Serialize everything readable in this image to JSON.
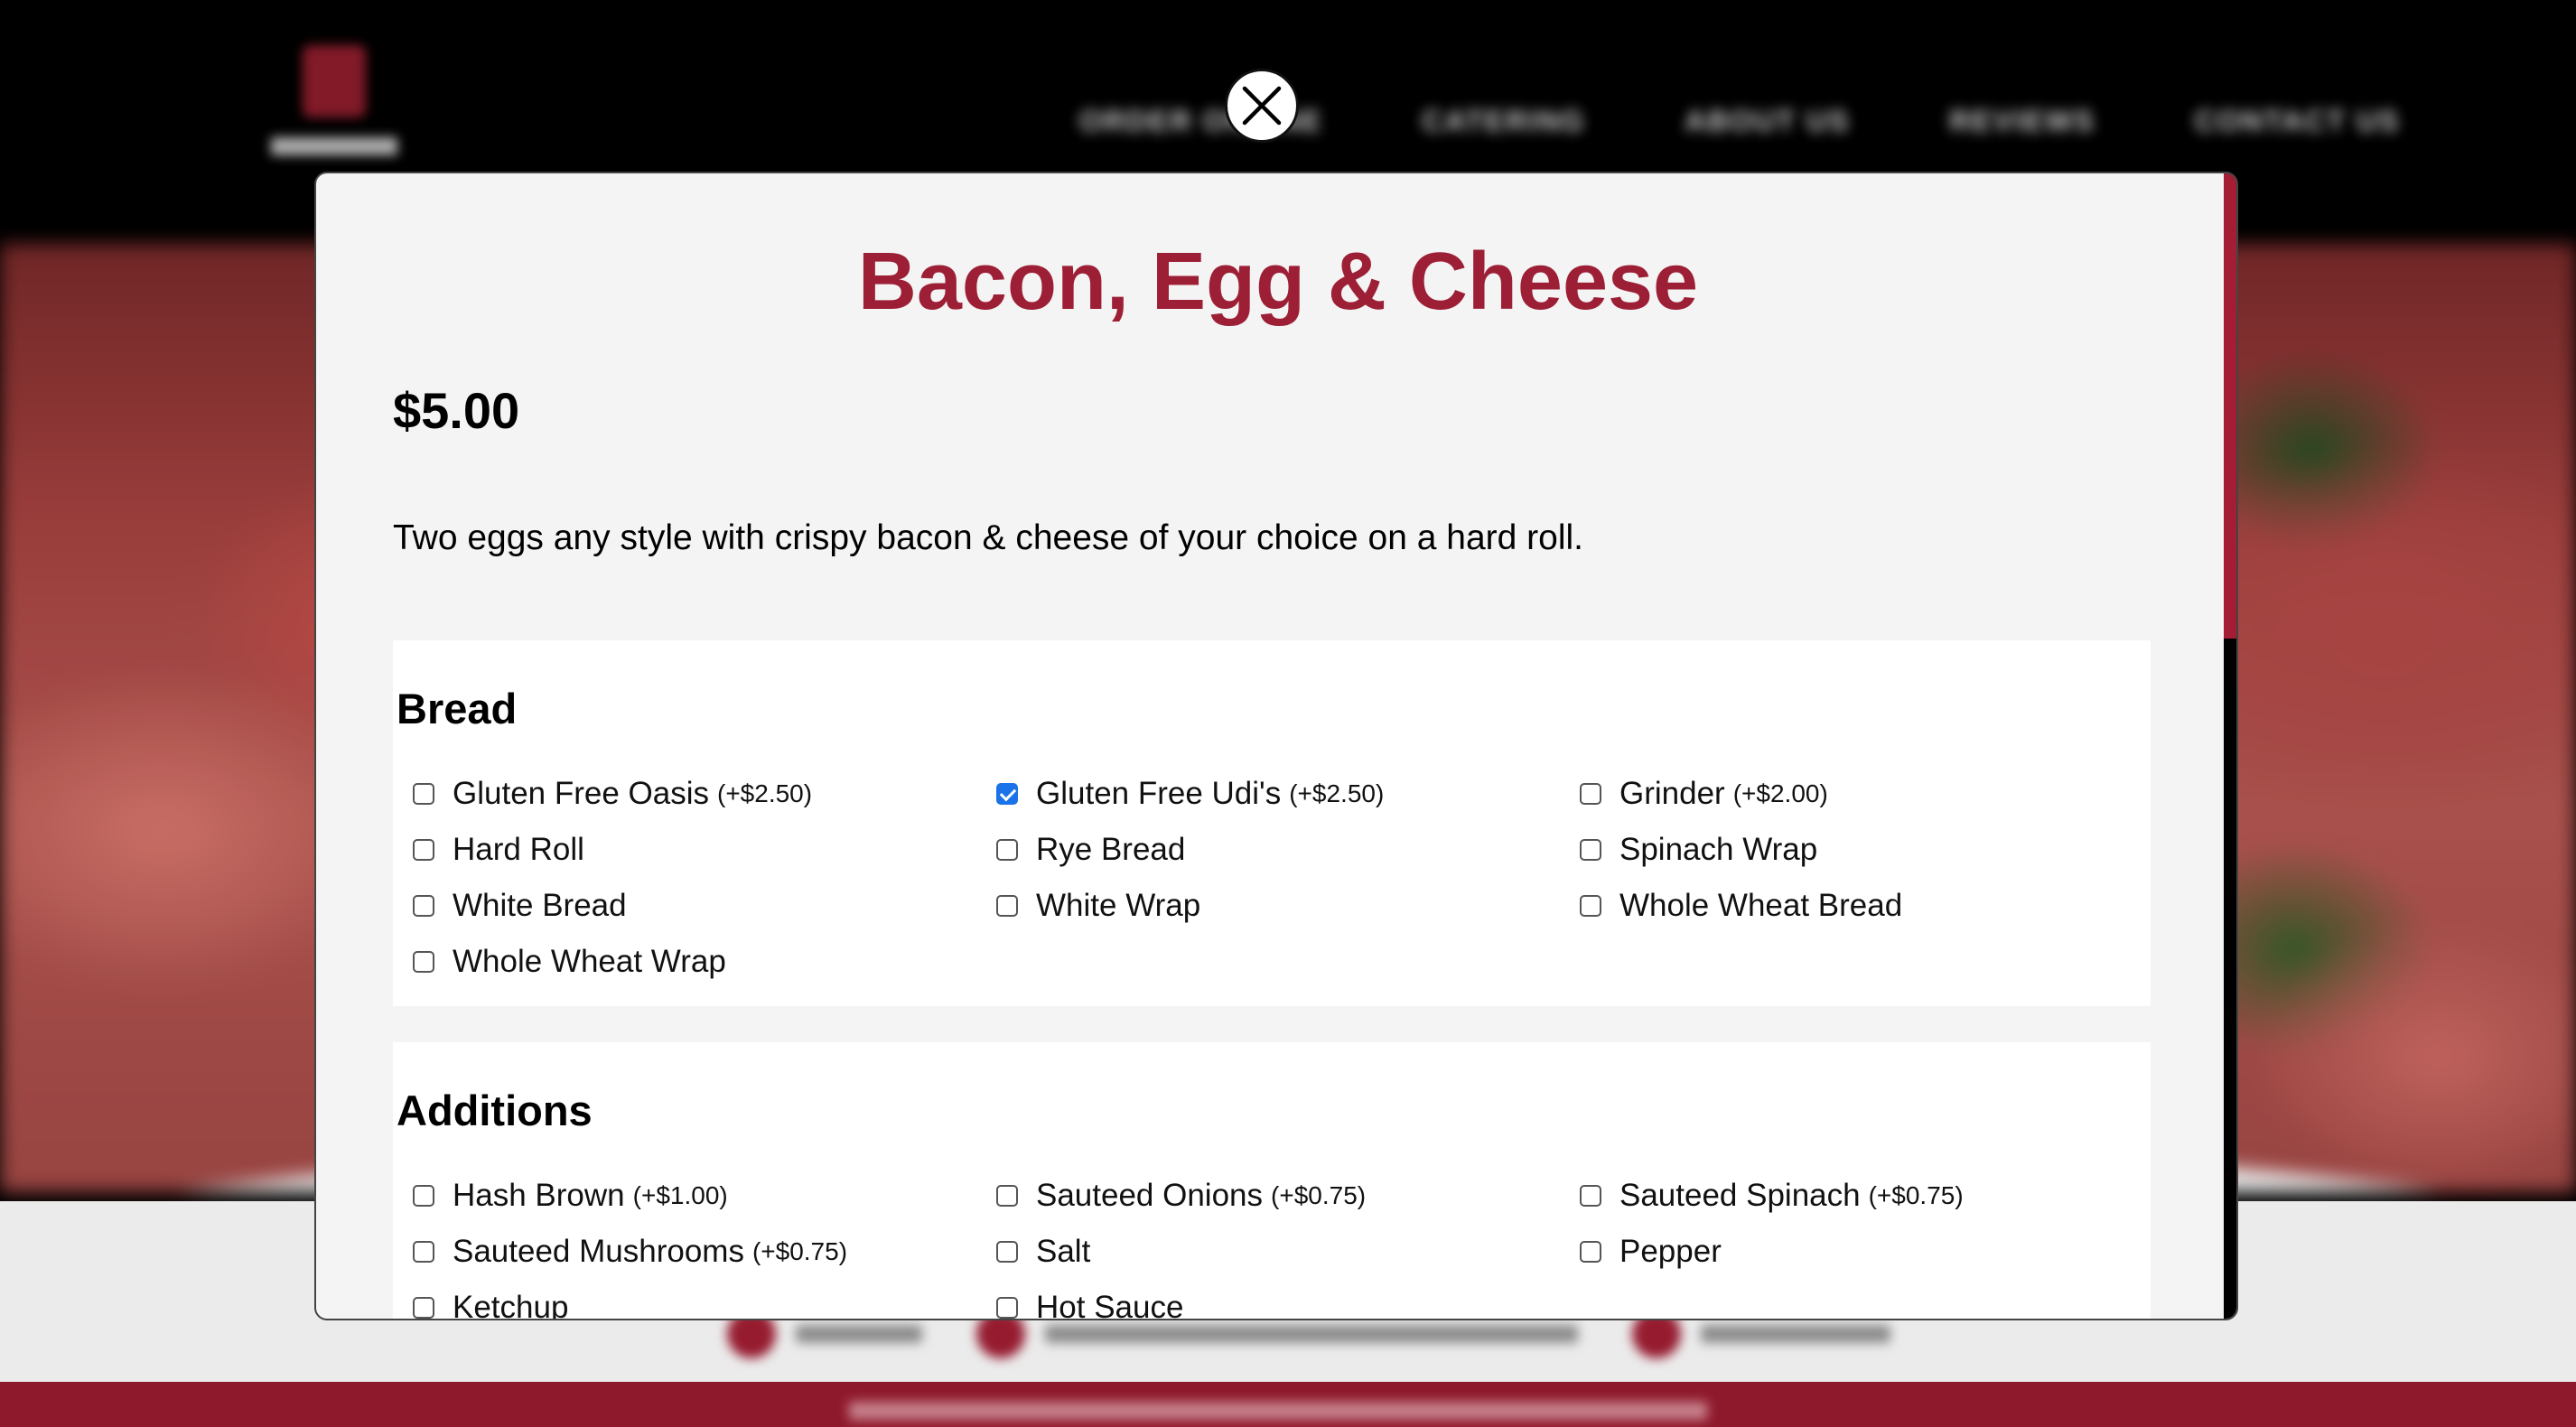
{
  "background": {
    "nav_items": [
      "ORDER ONLINE",
      "CATERING",
      "ABOUT US",
      "REVIEWS",
      "CONTACT US"
    ]
  },
  "modal": {
    "title": "Bacon, Egg & Cheese",
    "price": "$5.00",
    "description": "Two eggs any style with crispy bacon & cheese of your choice on a hard roll.",
    "sections": [
      {
        "title": "Bread",
        "options": [
          {
            "label": "Gluten Free Oasis",
            "price": "(+$2.50)",
            "checked": false
          },
          {
            "label": "Gluten Free Udi's",
            "price": "(+$2.50)",
            "checked": true
          },
          {
            "label": "Grinder",
            "price": "(+$2.00)",
            "checked": false
          },
          {
            "label": "Hard Roll",
            "price": "",
            "checked": false
          },
          {
            "label": "Rye Bread",
            "price": "",
            "checked": false
          },
          {
            "label": "Spinach Wrap",
            "price": "",
            "checked": false
          },
          {
            "label": "White Bread",
            "price": "",
            "checked": false
          },
          {
            "label": "White Wrap",
            "price": "",
            "checked": false
          },
          {
            "label": "Whole Wheat Bread",
            "price": "",
            "checked": false
          },
          {
            "label": "Whole Wheat Wrap",
            "price": "",
            "checked": false
          }
        ]
      },
      {
        "title": "Additions",
        "options": [
          {
            "label": "Hash Brown",
            "price": "(+$1.00)",
            "checked": false
          },
          {
            "label": "Sauteed Onions",
            "price": "(+$0.75)",
            "checked": false
          },
          {
            "label": "Sauteed Spinach",
            "price": "(+$0.75)",
            "checked": false
          },
          {
            "label": "Sauteed Mushrooms",
            "price": "(+$0.75)",
            "checked": false
          },
          {
            "label": "Salt",
            "price": "",
            "checked": false
          },
          {
            "label": "Pepper",
            "price": "",
            "checked": false
          },
          {
            "label": "Ketchup",
            "price": "",
            "checked": false
          },
          {
            "label": "Hot Sauce",
            "price": "",
            "checked": false
          }
        ]
      }
    ],
    "close_icon": "close-x-icon",
    "accent_color": "#9d1f36",
    "checkbox_checked_color": "#1a73e8"
  }
}
